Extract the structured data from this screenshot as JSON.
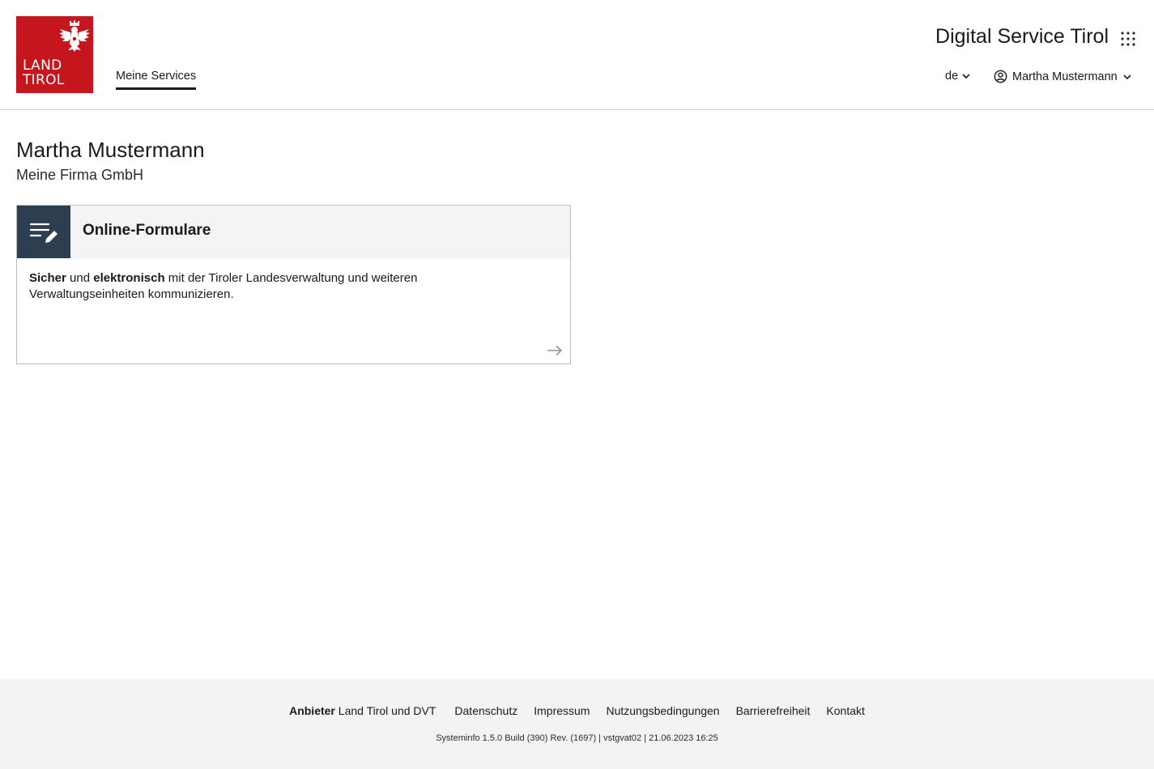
{
  "brand": {
    "logo_line1": "LAND",
    "logo_line2": "TIROL",
    "color": "#c4161c"
  },
  "header": {
    "app_title": "Digital Service Tirol",
    "apps_icon": "grid-dots-icon",
    "nav_tab": "Meine Services",
    "language": "de",
    "user_menu_label": "Martha Mustermann"
  },
  "main": {
    "user_name": "Martha Mustermann",
    "company": "Meine Firma GmbH",
    "card": {
      "icon": "form-edit-icon",
      "title": "Online-Formulare",
      "desc_bold1": "Sicher",
      "desc_text1": " und ",
      "desc_bold2": "elektronisch",
      "desc_text2": " mit der Tiroler Landesverwaltung und weiteren Verwaltungseinheiten kommunizieren.",
      "icon_bg": "#2c3e50"
    }
  },
  "footer": {
    "provider_label": "Anbieter",
    "provider_value": "Land Tirol und DVT",
    "links": [
      "Datenschutz",
      "Impressum",
      "Nutzungsbedingungen",
      "Barrierefreiheit",
      "Kontakt"
    ],
    "sysinfo": "Systeminfo 1.5.0 Build (390) Rev. (1697) | vstgvat02 | 21.06.2023 16:25"
  }
}
